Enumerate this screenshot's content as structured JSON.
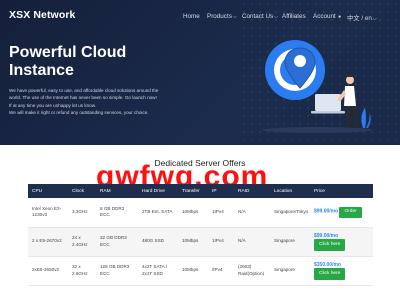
{
  "brand": {
    "name": "XSX Network"
  },
  "nav": {
    "home": "Home",
    "products": "Products",
    "contact": "Contact Us",
    "affiliates": "Affiliates",
    "account": "Account",
    "language": "中文 / en"
  },
  "hero": {
    "title_line1": "Powerful Cloud",
    "title_line2": "Instance",
    "desc_line1": "We have powerful, easy to use, and affordable cloud solutions around the",
    "desc_line2": "world. The use of the Internet has never been so simple. Go launch now!",
    "desc_line3": "If at any time you are unhappy let us know.",
    "desc_line4": "We will make it right or refund any outstanding services, your choice."
  },
  "offers": {
    "title": "Dedicated Server Offers",
    "watermark": "qwfwq.com",
    "columns": [
      "CPU",
      "Clock",
      "RAM",
      "Hard Drive",
      "Transfer",
      "IP",
      "RAID",
      "Location",
      "Price"
    ],
    "rows": [
      {
        "cpu": "Intel Xeon E3-1230v3",
        "clock": "3.3GHz",
        "ram": "8 GB DDR3 ECC",
        "disk": "2TB Ent. SATA",
        "transfer": "10Mbps",
        "ip": "1IPv4",
        "raid": "N/A",
        "location": "Singapore/Tokyo",
        "price": "$99.00",
        "per": "/mo",
        "action": "Order"
      },
      {
        "cpu": "2 x E5-2670v2",
        "clock": "24 x 2.4GHz",
        "ram": "32 GB DDR3 ECC",
        "disk": "480G SSD",
        "transfer": "10Mbps",
        "ip": "1IPv4",
        "raid": "N/A",
        "location": "Singapore",
        "price": "$99.00",
        "per": "/mo",
        "action": "Click here"
      },
      {
        "cpu": "2xE5-2650v2",
        "clock": "32 x 2.6GHz",
        "ram": "128 GB DDR3 ECC",
        "disk": "4x2T SATA / 2x1T SSD",
        "transfer": "10Mbps",
        "ip": "/IPv4",
        "raid": "(2603) Raid(Option)",
        "location": "Singapore",
        "price": "$350.00",
        "per": "/mo",
        "action": "Click here"
      }
    ]
  },
  "colors": {
    "hero_bg": "#1b2b4c",
    "accent": "#2a7be4",
    "button": "#28a745",
    "watermark": "#ff1010"
  }
}
